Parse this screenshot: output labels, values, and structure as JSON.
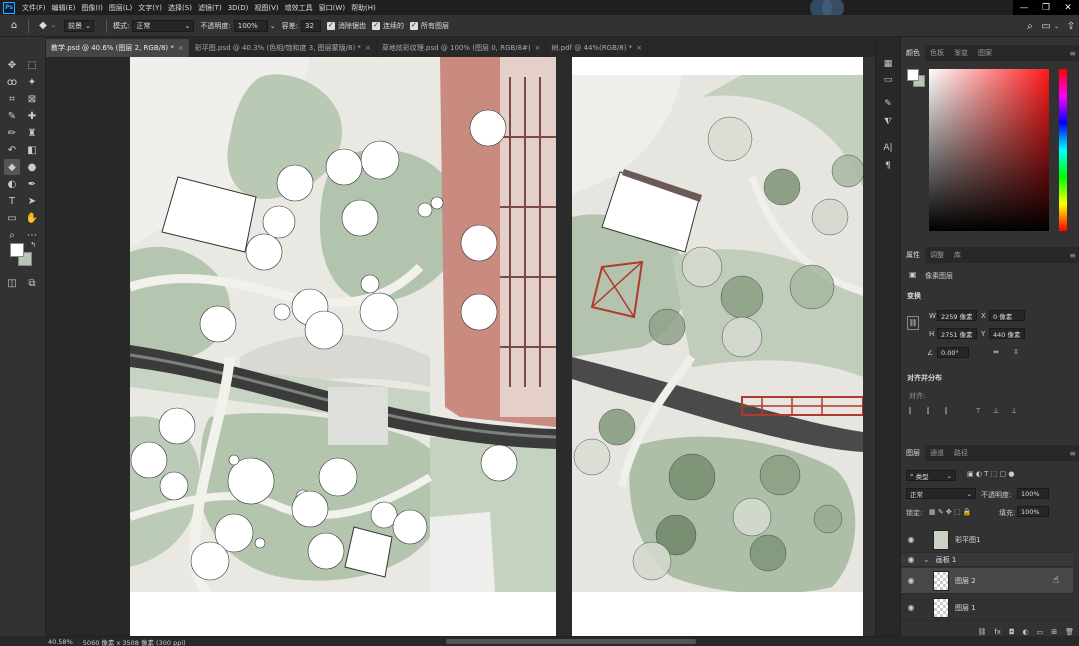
{
  "app": {
    "logo": "Ps"
  },
  "menu": [
    "文件(F)",
    "编辑(E)",
    "图像(I)",
    "图层(L)",
    "文字(Y)",
    "选择(S)",
    "滤镜(T)",
    "3D(D)",
    "视图(V)",
    "增效工具",
    "窗口(W)",
    "帮助(H)"
  ],
  "options": {
    "preset_label": "前景",
    "mode_label": "模式:",
    "mode_value": "正常",
    "opacity_label": "不透明度:",
    "opacity_value": "100%",
    "tolerance_label": "容差:",
    "tolerance_value": "32",
    "antialias_label": "消除锯齿",
    "contiguous_label": "连续的",
    "all_layers_label": "所有图层"
  },
  "tabs": [
    {
      "label": "教学.psd @ 40.6% (图层 2, RGB/8) *",
      "close": "×"
    },
    {
      "label": "彩平图.psd @ 40.3% (色相/饱和度 3, 图层蒙版/8) *",
      "close": "×"
    },
    {
      "label": "草地炫彩纹理.psd @ 100% (图层 0, RGB/8#)",
      "close": "×"
    },
    {
      "label": "树.pdf @ 44%(RGB/8) *",
      "close": "×"
    }
  ],
  "color_panel": {
    "tabs": [
      "颜色",
      "色板",
      "渐变",
      "图案"
    ]
  },
  "properties_panel": {
    "tabs": [
      "属性",
      "调整",
      "库"
    ],
    "type_label": "像素图层",
    "transform_title": "变换",
    "w_label": "W",
    "w_value": "2259 像素",
    "x_label": "X",
    "x_value": "0 像素",
    "h_label": "H",
    "h_value": "2751 像素",
    "y_label": "Y",
    "y_value": "440 像素",
    "angle_value": "0.00°",
    "align_title": "对齐并分布",
    "align_label": "对齐:"
  },
  "layers_panel": {
    "tabs": [
      "图层",
      "通道",
      "路径"
    ],
    "filter_label": "类型",
    "blend_mode": "正常",
    "opacity_label": "不透明度:",
    "opacity_value": "100%",
    "lock_label": "锁定:",
    "fill_label": "填充:",
    "fill_value": "100%",
    "layers": [
      {
        "name": "彩平图1",
        "type": "image"
      },
      {
        "name": "画板 1",
        "type": "group"
      },
      {
        "name": "图层 2",
        "type": "layer",
        "selected": true
      },
      {
        "name": "图层 1",
        "type": "layer"
      }
    ]
  },
  "status": {
    "zoom": "40.58%",
    "doc_size": "5060 像素 x 3508 像素 (300 ppi)"
  },
  "colors": {
    "accent": "#31a8ff",
    "grass": "#b6c7b2",
    "path": "#eaeae6",
    "brick": "#c9877d",
    "water": "#3a3a3a"
  }
}
